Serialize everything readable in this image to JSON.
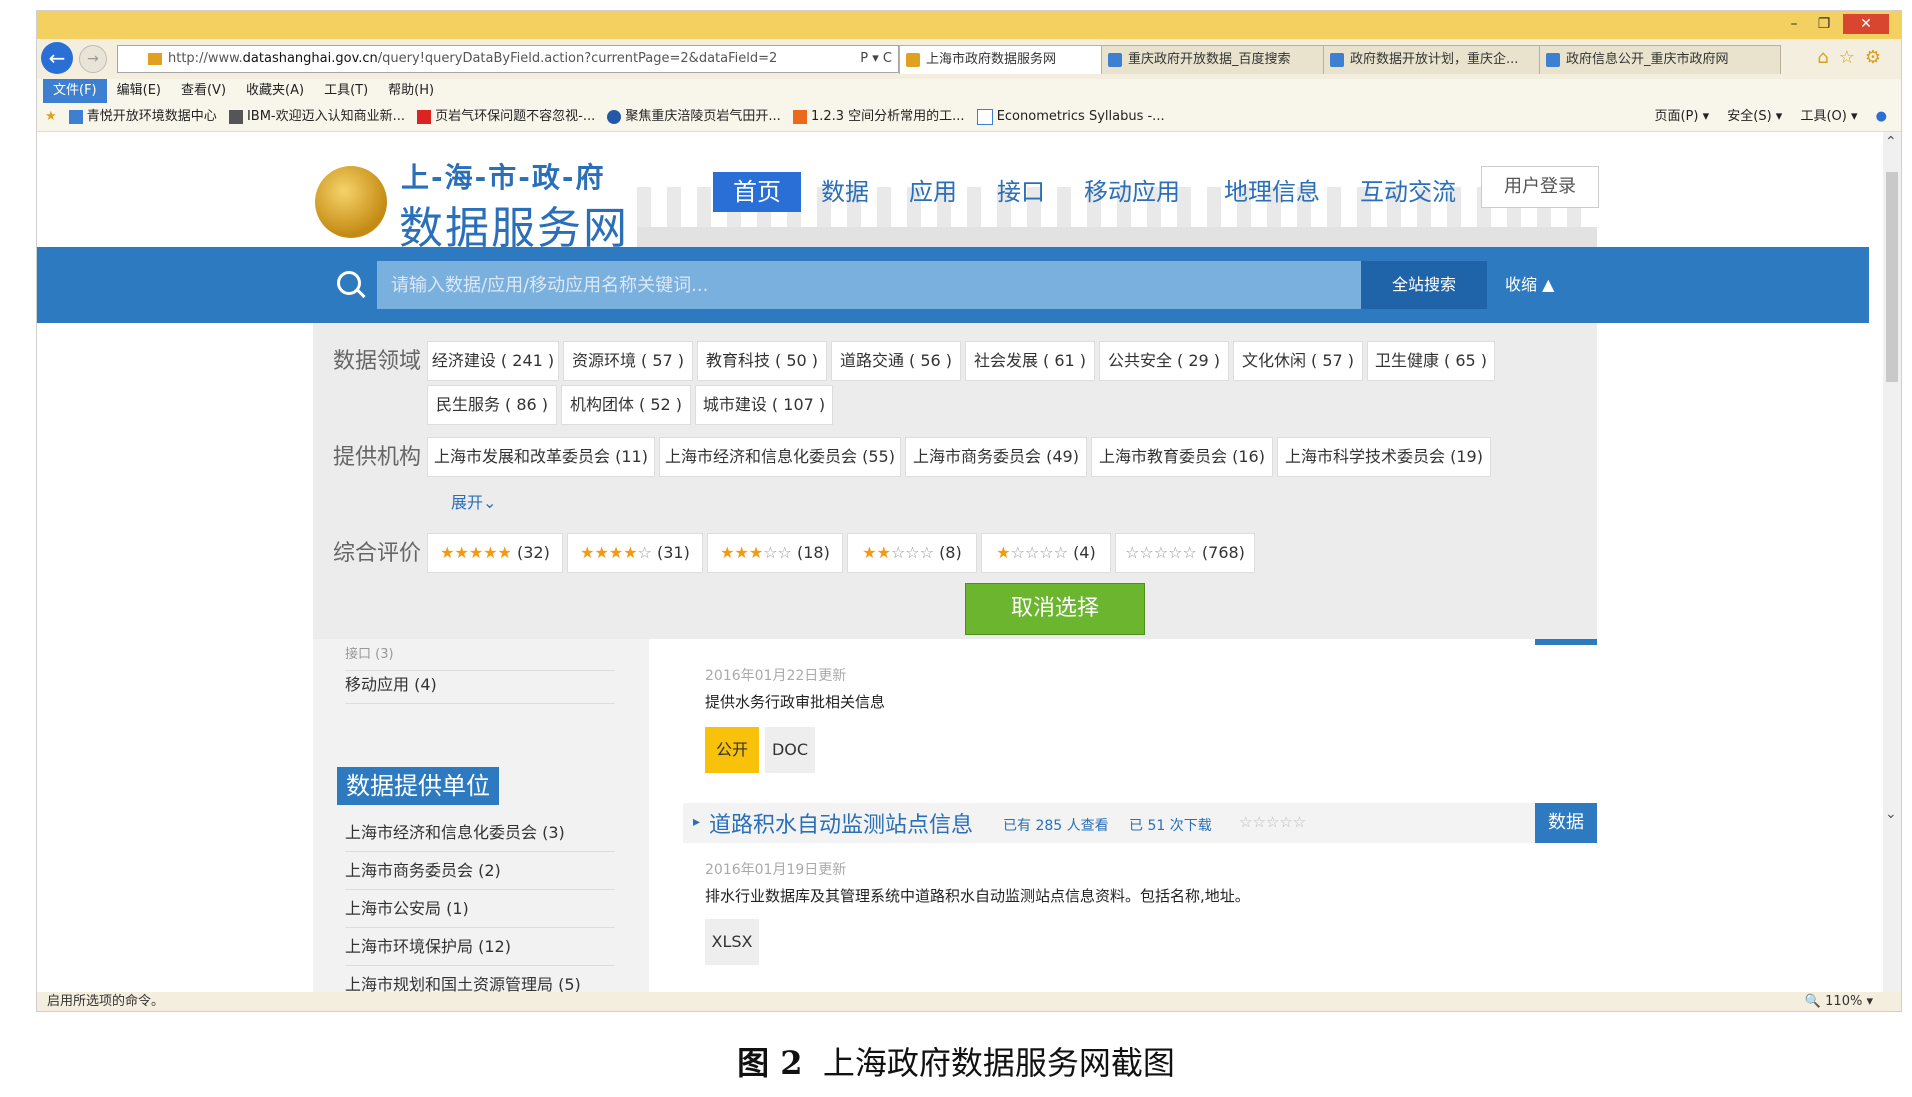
{
  "browser": {
    "url_prefix": "http://www.",
    "url_host": "datashanghai.gov.cn",
    "url_path": "/query!queryDataByField.action?currentPage=2&dataField=2",
    "addr_tools": "P ▾ C",
    "tabs": [
      {
        "label": "上海市政府数据服务网"
      },
      {
        "label": "重庆政府开放数据_百度搜索"
      },
      {
        "label": "政府数据开放计划，重庆企..."
      },
      {
        "label": "政府信息公开_重庆市政府网"
      }
    ],
    "menu": [
      "文件(F)",
      "编辑(E)",
      "查看(V)",
      "收藏夹(A)",
      "工具(T)",
      "帮助(H)"
    ],
    "favorites": [
      "青悦开放环境数据中心",
      "IBM-欢迎迈入认知商业新...",
      "页岩气环保问题不容忽视-...",
      "聚焦重庆涪陵页岩气田开...",
      "1.2.3 空间分析常用的工...",
      "Econometrics Syllabus -..."
    ],
    "fav_tools": [
      "页面(P) ▾",
      "安全(S) ▾",
      "工具(O) ▾"
    ],
    "status_text": "启用所选项的命令。",
    "zoom": "110%"
  },
  "site": {
    "logo_line1": "上-海-市-政-府",
    "logo_line2": "数据服务网",
    "nav": [
      "首页",
      "数据",
      "应用",
      "接口",
      "移动应用",
      "地理信息",
      "互动交流"
    ],
    "login": "用户登录",
    "search_placeholder": "请输入数据/应用/移动应用名称关键词...",
    "search_button": "全站搜索",
    "collapse": "收缩 ▲"
  },
  "filters": {
    "domain_label": "数据领域",
    "domains": [
      "经济建设 ( 241 )",
      "资源环境 ( 57 )",
      "教育科技 ( 50 )",
      "道路交通 ( 56 )",
      "社会发展 ( 61 )",
      "公共安全 ( 29 )",
      "文化休闲 ( 57 )",
      "卫生健康 ( 65 )",
      "民生服务 ( 86 )",
      "机构团体 ( 52 )",
      "城市建设 ( 107 )"
    ],
    "org_label": "提供机构",
    "orgs": [
      "上海市发展和改革委员会 (11)",
      "上海市经济和信息化委员会 (55)",
      "上海市商务委员会 (49)",
      "上海市教育委员会 (16)",
      "上海市科学技术委员会 (19)"
    ],
    "expand": "展开⌄",
    "rating_label": "综合评价",
    "ratings": [
      {
        "filled": "★★★★★",
        "empty": "",
        "count": "(32)"
      },
      {
        "filled": "★★★★",
        "empty": "☆",
        "count": "(31)"
      },
      {
        "filled": "★★★",
        "empty": "☆☆",
        "count": "(18)"
      },
      {
        "filled": "★★",
        "empty": "☆☆☆",
        "count": "(8)"
      },
      {
        "filled": "★",
        "empty": "☆☆☆☆",
        "count": "(4)"
      },
      {
        "filled": "",
        "empty": "☆☆☆☆☆",
        "count": "(768)"
      }
    ],
    "cancel": "取消选择"
  },
  "sidebar": {
    "partial_item": "接口 (3)",
    "mobile_item": "移动应用 (4)",
    "provider_title": "数据提供单位",
    "providers": [
      "上海市经济和信息化委员会 (3)",
      "上海市商务委员会 (2)",
      "上海市公安局 (1)",
      "上海市环境保护局 (12)",
      "上海市规划和国土资源管理局 (5)"
    ]
  },
  "results": {
    "r1_date": "2016年01月22日更新",
    "r1_desc": "提供水务行政审批相关信息",
    "r1_tag_public": "公开",
    "r1_tag_doc": "DOC",
    "r2_title": "道路积水自动监测站点信息",
    "r2_views": "已有 285 人查看",
    "r2_downloads": "已 51 次下载",
    "r2_stars": "☆☆☆☆☆",
    "r2_btn": "数据",
    "r2_date": "2016年01月19日更新",
    "r2_desc": "排水行业数据库及其管理系统中道路积水自动监测站点信息资料。包括名称,地址。",
    "r2_tag": "XLSX"
  },
  "caption": {
    "figure": "图 2",
    "text": "上海政府数据服务网截图"
  }
}
